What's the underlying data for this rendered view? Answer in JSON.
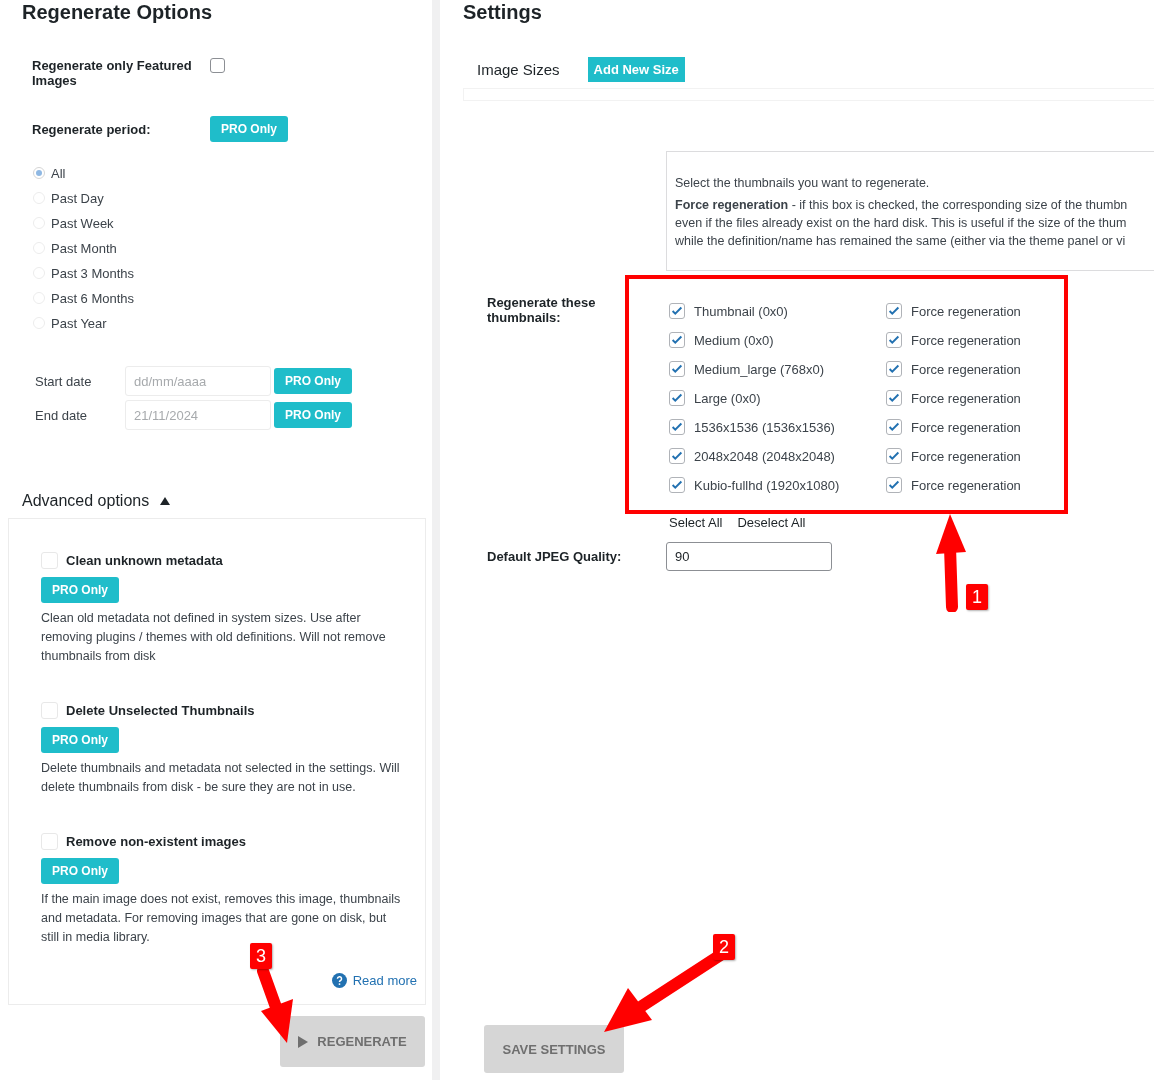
{
  "options_panel": {
    "title": "Regenerate Options",
    "featured_only": {
      "label": "Regenerate only Featured Images",
      "checked": false
    },
    "period": {
      "label": "Regenerate period:",
      "badge": "PRO Only",
      "choices": [
        {
          "label": "All",
          "selected": true
        },
        {
          "label": "Past Day",
          "selected": false
        },
        {
          "label": "Past Week",
          "selected": false
        },
        {
          "label": "Past Month",
          "selected": false
        },
        {
          "label": "Past 3 Months",
          "selected": false
        },
        {
          "label": "Past 6 Months",
          "selected": false
        },
        {
          "label": "Past Year",
          "selected": false
        }
      ]
    },
    "dates": [
      {
        "label": "Start date",
        "placeholder": "dd/mm/aaaa",
        "badge": "PRO Only"
      },
      {
        "label": "End date",
        "value": "21/11/2024",
        "badge": "PRO Only"
      }
    ],
    "advanced": {
      "title": "Advanced options",
      "expanded": true,
      "items": [
        {
          "label": "Clean unknown metadata",
          "checked": false,
          "badge": "PRO Only",
          "description": "Clean old metadata not defined in system sizes. Use after removing plugins / themes with old definitions. Will not remove thumbnails from disk"
        },
        {
          "label": "Delete Unselected Thumbnails",
          "checked": false,
          "badge": "PRO Only",
          "description": "Delete thumbnails and metadata not selected in the settings. Will delete thumbnails from disk - be sure they are not in use."
        },
        {
          "label": "Remove non-existent images",
          "checked": false,
          "badge": "PRO Only",
          "description": "If the main image does not exist, removes this image, thumbnails and metadata. For removing images that are gone on disk, but still in media library."
        }
      ],
      "read_more": "Read more"
    },
    "regenerate_button": {
      "label": "REGENERATE",
      "disabled": true
    }
  },
  "settings_panel": {
    "title": "Settings",
    "tab": "Image Sizes",
    "add_button": "Add New Size",
    "help": {
      "intro": "Select the thumbnails you want to regenerate.",
      "text": "**Force regeneration** - if this box is checked, the corresponding size of the thumbn even if the files already exist on the hard disk. This is useful if the size of the thum while the definition/name has remained the same (either via the theme panel or vi"
    },
    "thumbnails": {
      "label": "Regenerate these thumbnails:",
      "rows": [
        {
          "name": "Thumbnail (0x0)",
          "checked": true,
          "force_label": "Force regeneration",
          "force": true
        },
        {
          "name": "Medium (0x0)",
          "checked": true,
          "force_label": "Force regeneration",
          "force": true
        },
        {
          "name": "Medium_large (768x0)",
          "checked": true,
          "force_label": "Force regeneration",
          "force": true
        },
        {
          "name": "Large (0x0)",
          "checked": true,
          "force_label": "Force regeneration",
          "force": true
        },
        {
          "name": "1536x1536 (1536x1536)",
          "checked": true,
          "force_label": "Force regeneration",
          "force": true
        },
        {
          "name": "2048x2048 (2048x2048)",
          "checked": true,
          "force_label": "Force regeneration",
          "force": true
        },
        {
          "name": "Kubio-fullhd (1920x1080)",
          "checked": true,
          "force_label": "Force regeneration",
          "force": true
        }
      ],
      "select_all": "Select All",
      "deselect_all": "Deselect All"
    },
    "jpeg_quality": {
      "label": "Default JPEG Quality:",
      "value": "90"
    },
    "save_button": {
      "label": "SAVE SETTINGS",
      "disabled": true
    }
  },
  "annotations": [
    {
      "label": "1"
    },
    {
      "label": "2"
    },
    {
      "label": "3"
    }
  ]
}
